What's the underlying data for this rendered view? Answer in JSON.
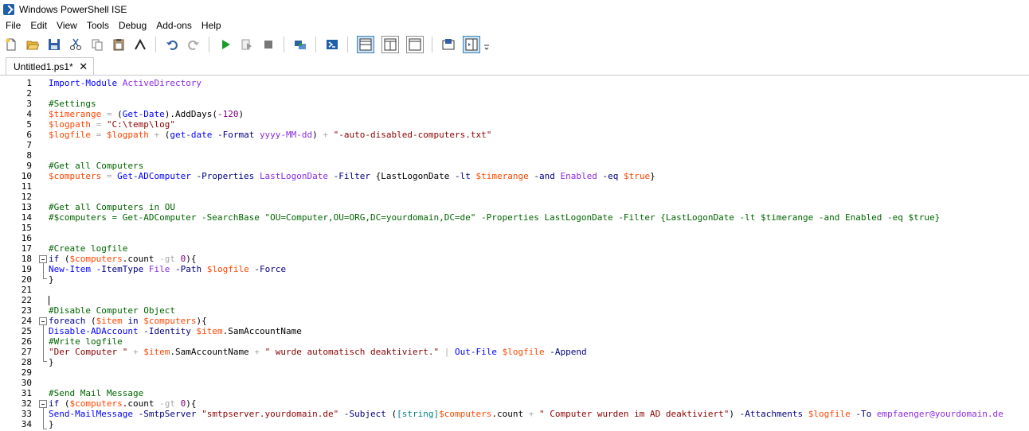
{
  "window": {
    "title": "Windows PowerShell ISE"
  },
  "menu": [
    "File",
    "Edit",
    "View",
    "Tools",
    "Debug",
    "Add-ons",
    "Help"
  ],
  "toolbar": {
    "icons": [
      "new-file-icon",
      "open-folder-icon",
      "save-icon",
      "cut-icon",
      "copy-icon",
      "paste-icon",
      "clear-console-icon",
      "undo-icon",
      "redo-icon",
      "run-icon",
      "run-selection-icon",
      "stop-icon",
      "remote-tab-icon",
      "powershell-icon",
      "layout-top-icon",
      "layout-right-icon",
      "layout-max-icon",
      "show-commands-icon",
      "show-addon-icon",
      "overflow-icon"
    ]
  },
  "tab": {
    "label": "Untitled1.ps1*",
    "close": "✕"
  },
  "line_numbers": [
    "1",
    "2",
    "3",
    "4",
    "5",
    "6",
    "7",
    "8",
    "9",
    "10",
    "11",
    "12",
    "13",
    "14",
    "15",
    "16",
    "17",
    "18",
    "19",
    "20",
    "21",
    "22",
    "23",
    "24",
    "25",
    "26",
    "27",
    "28",
    "29",
    "30",
    "31",
    "32",
    "33",
    "34"
  ],
  "code_lines": [
    [
      [
        "cmd",
        "Import-Module"
      ],
      [
        "plain",
        " "
      ],
      [
        "arg",
        "ActiveDirectory"
      ]
    ],
    [],
    [
      [
        "com",
        "#Settings"
      ]
    ],
    [
      [
        "var",
        "$timerange"
      ],
      [
        "plain",
        " "
      ],
      [
        "op",
        "="
      ],
      [
        "plain",
        " ("
      ],
      [
        "cmd",
        "Get-Date"
      ],
      [
        "plain",
        ")."
      ],
      [
        "member",
        "AddDays"
      ],
      [
        "plain",
        "("
      ],
      [
        "num",
        "-120"
      ],
      [
        "plain",
        ")"
      ]
    ],
    [
      [
        "var",
        "$logpath"
      ],
      [
        "plain",
        " "
      ],
      [
        "op",
        "="
      ],
      [
        "plain",
        " "
      ],
      [
        "str",
        "\"C:\\temp\\log\""
      ]
    ],
    [
      [
        "var",
        "$logfile"
      ],
      [
        "plain",
        " "
      ],
      [
        "op",
        "="
      ],
      [
        "plain",
        " "
      ],
      [
        "var",
        "$logpath"
      ],
      [
        "plain",
        " "
      ],
      [
        "op",
        "+"
      ],
      [
        "plain",
        " ("
      ],
      [
        "cmd",
        "get-date"
      ],
      [
        "plain",
        " "
      ],
      [
        "param",
        "-Format"
      ],
      [
        "plain",
        " "
      ],
      [
        "arg",
        "yyyy-MM-dd"
      ],
      [
        "plain",
        ") "
      ],
      [
        "op",
        "+"
      ],
      [
        "plain",
        " "
      ],
      [
        "str",
        "\"-auto-disabled-computers.txt\""
      ]
    ],
    [],
    [],
    [
      [
        "com",
        "#Get all Computers"
      ]
    ],
    [
      [
        "var",
        "$computers"
      ],
      [
        "plain",
        " "
      ],
      [
        "op",
        "="
      ],
      [
        "plain",
        " "
      ],
      [
        "cmd",
        "Get-ADComputer"
      ],
      [
        "plain",
        " "
      ],
      [
        "param",
        "-Properties"
      ],
      [
        "plain",
        " "
      ],
      [
        "arg",
        "LastLogonDate"
      ],
      [
        "plain",
        " "
      ],
      [
        "param",
        "-Filter"
      ],
      [
        "plain",
        " {"
      ],
      [
        "plain",
        "LastLogonDate "
      ],
      [
        "param",
        "-lt"
      ],
      [
        "plain",
        " "
      ],
      [
        "var",
        "$timerange"
      ],
      [
        "plain",
        " "
      ],
      [
        "param",
        "-and"
      ],
      [
        "plain",
        " "
      ],
      [
        "arg",
        "Enabled"
      ],
      [
        "plain",
        " "
      ],
      [
        "param",
        "-eq"
      ],
      [
        "plain",
        " "
      ],
      [
        "var",
        "$true"
      ],
      [
        "plain",
        "}"
      ]
    ],
    [],
    [],
    [
      [
        "com",
        "#Get all Computers in OU"
      ]
    ],
    [
      [
        "com",
        "#$computers = Get-ADComputer -SearchBase \"OU=Computer,OU=ORG,DC=yourdomain,DC=de\" -Properties LastLogonDate -Filter {LastLogonDate -lt $timerange -and Enabled -eq $true}"
      ]
    ],
    [],
    [],
    [
      [
        "com",
        "#Create logfile"
      ]
    ],
    [
      [
        "kw",
        "if"
      ],
      [
        "plain",
        " ("
      ],
      [
        "var",
        "$computers"
      ],
      [
        "plain",
        "."
      ],
      [
        "member",
        "count"
      ],
      [
        "plain",
        " "
      ],
      [
        "op",
        "-gt"
      ],
      [
        "plain",
        " "
      ],
      [
        "num",
        "0"
      ],
      [
        "plain",
        "){"
      ]
    ],
    [
      [
        "cmd",
        "New-Item"
      ],
      [
        "plain",
        " "
      ],
      [
        "param",
        "-ItemType"
      ],
      [
        "plain",
        " "
      ],
      [
        "arg",
        "File"
      ],
      [
        "plain",
        " "
      ],
      [
        "param",
        "-Path"
      ],
      [
        "plain",
        " "
      ],
      [
        "var",
        "$logfile"
      ],
      [
        "plain",
        " "
      ],
      [
        "param",
        "-Force"
      ]
    ],
    [
      [
        "plain",
        "}"
      ]
    ],
    [],
    [],
    [
      [
        "com",
        "#Disable Computer Object"
      ]
    ],
    [
      [
        "kw",
        "foreach"
      ],
      [
        "plain",
        " ("
      ],
      [
        "var",
        "$item"
      ],
      [
        "plain",
        " "
      ],
      [
        "kw",
        "in"
      ],
      [
        "plain",
        " "
      ],
      [
        "var",
        "$computers"
      ],
      [
        "plain",
        "){"
      ]
    ],
    [
      [
        "cmd",
        "Disable-ADAccount"
      ],
      [
        "plain",
        " "
      ],
      [
        "param",
        "-Identity"
      ],
      [
        "plain",
        " "
      ],
      [
        "var",
        "$item"
      ],
      [
        "plain",
        "."
      ],
      [
        "member",
        "SamAccountName"
      ]
    ],
    [
      [
        "com",
        "#Write logfile"
      ]
    ],
    [
      [
        "str",
        "\"Der Computer \""
      ],
      [
        "plain",
        " "
      ],
      [
        "op",
        "+"
      ],
      [
        "plain",
        " "
      ],
      [
        "var",
        "$item"
      ],
      [
        "plain",
        "."
      ],
      [
        "member",
        "SamAccountName"
      ],
      [
        "plain",
        " "
      ],
      [
        "op",
        "+"
      ],
      [
        "plain",
        " "
      ],
      [
        "str",
        "\" wurde automatisch deaktiviert.\""
      ],
      [
        "plain",
        " "
      ],
      [
        "op",
        "|"
      ],
      [
        "plain",
        " "
      ],
      [
        "cmd",
        "Out-File"
      ],
      [
        "plain",
        " "
      ],
      [
        "var",
        "$logfile"
      ],
      [
        "plain",
        " "
      ],
      [
        "param",
        "-Append"
      ]
    ],
    [
      [
        "plain",
        "}"
      ]
    ],
    [],
    [],
    [
      [
        "com",
        "#Send Mail Message"
      ]
    ],
    [
      [
        "kw",
        "if"
      ],
      [
        "plain",
        " ("
      ],
      [
        "var",
        "$computers"
      ],
      [
        "plain",
        "."
      ],
      [
        "member",
        "count"
      ],
      [
        "plain",
        " "
      ],
      [
        "op",
        "-gt"
      ],
      [
        "plain",
        " "
      ],
      [
        "num",
        "0"
      ],
      [
        "plain",
        "){"
      ]
    ],
    [
      [
        "cmd",
        "Send-MailMessage"
      ],
      [
        "plain",
        " "
      ],
      [
        "param",
        "-SmtpServer"
      ],
      [
        "plain",
        " "
      ],
      [
        "str",
        "\"smtpserver.yourdomain.de\""
      ],
      [
        "plain",
        " "
      ],
      [
        "param",
        "-Subject"
      ],
      [
        "plain",
        " ("
      ],
      [
        "type",
        "[string]"
      ],
      [
        "var",
        "$computers"
      ],
      [
        "plain",
        "."
      ],
      [
        "member",
        "count"
      ],
      [
        "plain",
        " "
      ],
      [
        "op",
        "+"
      ],
      [
        "plain",
        " "
      ],
      [
        "str",
        "\" Computer wurden im AD deaktiviert\""
      ],
      [
        "plain",
        ") "
      ],
      [
        "param",
        "-Attachments"
      ],
      [
        "plain",
        " "
      ],
      [
        "var",
        "$logfile"
      ],
      [
        "plain",
        " "
      ],
      [
        "param",
        "-To"
      ],
      [
        "plain",
        " "
      ],
      [
        "arg",
        "empfaenger@yourdomain.de"
      ]
    ],
    [
      [
        "plain",
        "}"
      ]
    ]
  ]
}
